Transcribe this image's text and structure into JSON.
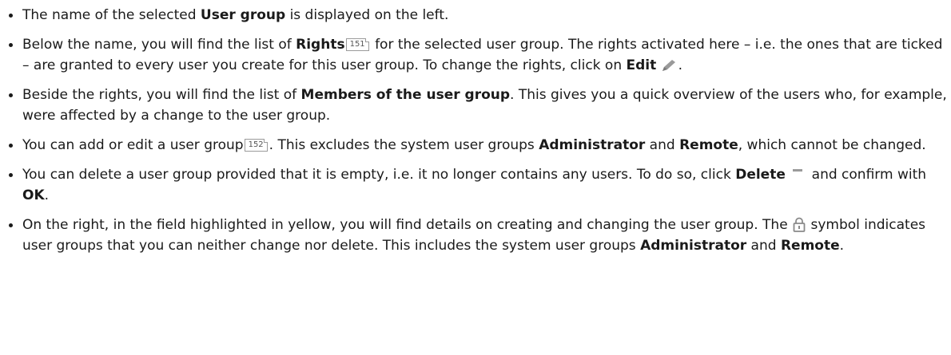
{
  "bullets": [
    {
      "t1": "The name of the selected ",
      "b1": "User group",
      "t2": " is displayed on the left."
    },
    {
      "t1": "Below the name, you will find the list of ",
      "b1": "Rights",
      "ref": "151",
      "t2": " for the selected user group. The rights activated here – i.e. the ones that are ticked – are granted to every user you create for this user group. To change the rights, click on ",
      "b2": "Edit",
      "t3": "."
    },
    {
      "t1": "Beside the rights, you will find the list of ",
      "b1": "Members of the user group",
      "t2": ". This gives you a quick overview of the users who, for example, were affected by a change to the user group."
    },
    {
      "t1": "You can add or edit a user group",
      "ref": "152",
      "t2": ". This excludes the system user groups ",
      "b1": "Administrator",
      "t3": " and ",
      "b2": "Remote",
      "t4": ", which cannot be changed."
    },
    {
      "t1": "You can delete a user group provided that it is empty, i.e. it no longer contains any users. To do so, click ",
      "b1": "Delete",
      "t2": " and confirm with ",
      "b2": "OK",
      "t3": "."
    },
    {
      "t1": "On the right, in the field highlighted in yellow, you will find details on creating and changing the user group. The ",
      "t2": " symbol indicates user groups that you can neither change nor delete. This includes the system user groups ",
      "b1": "Administrator",
      "t3": " and ",
      "b2": "Remote",
      "t4": "."
    }
  ],
  "icons": {
    "edit": "pencil-icon",
    "delete": "minus-icon",
    "lock": "lock-icon"
  },
  "colors": {
    "text": "#1a1a1a",
    "icon_gray": "#9a9a9a"
  }
}
